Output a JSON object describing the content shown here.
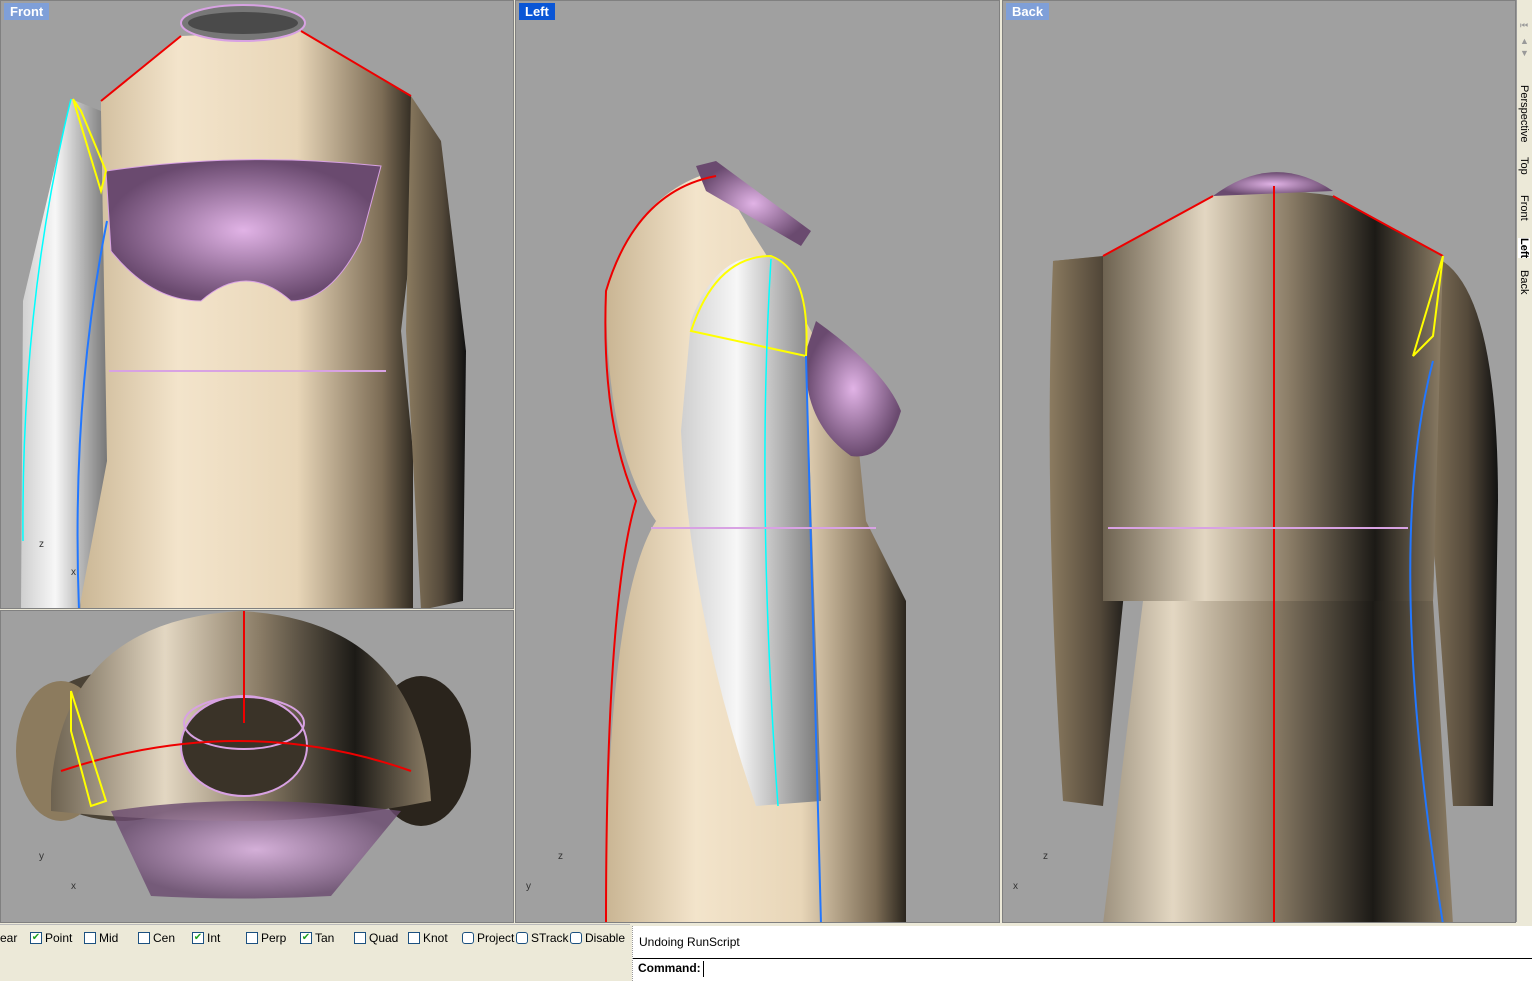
{
  "viewports": {
    "front": {
      "label": "Front",
      "axis_v": "z",
      "axis_h": "x"
    },
    "top": {
      "axis_v": "y",
      "axis_h": "x"
    },
    "left": {
      "label": "Left",
      "axis_v": "z",
      "axis_h": "y"
    },
    "back": {
      "label": "Back",
      "axis_v": "z",
      "axis_h": "x"
    }
  },
  "viewport_tabs": [
    "Perspective",
    "Top",
    "Front",
    "Left",
    "Back"
  ],
  "active_tab": "Left",
  "osnap": [
    {
      "label": "ear",
      "checked": null
    },
    {
      "label": "Point",
      "checked": true
    },
    {
      "label": "Mid",
      "checked": false
    },
    {
      "label": "Cen",
      "checked": false
    },
    {
      "label": "Int",
      "checked": true
    },
    {
      "label": "Perp",
      "checked": false
    },
    {
      "label": "Tan",
      "checked": true
    },
    {
      "label": "Quad",
      "checked": false
    },
    {
      "label": "Knot",
      "checked": false
    },
    {
      "label": "Project",
      "checked": false
    },
    {
      "label": "STrack",
      "checked": false
    },
    {
      "label": "Disable",
      "checked": false
    }
  ],
  "command": {
    "history": "Undoing RunScript",
    "prompt": "Command:",
    "value": ""
  }
}
